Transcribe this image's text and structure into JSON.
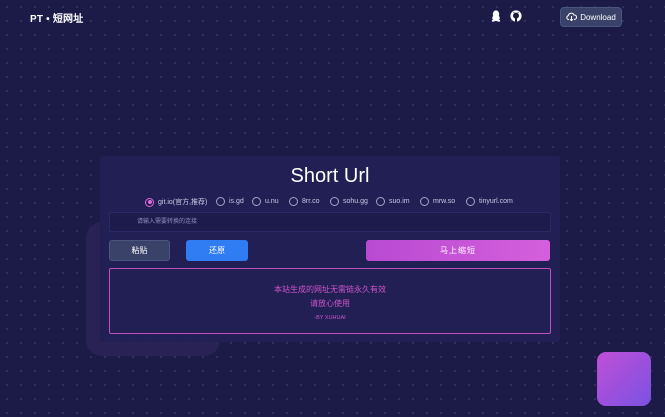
{
  "header": {
    "brand": "PT • 短网址",
    "icons": [
      "qq-penguin-icon",
      "github-icon"
    ],
    "download_label": "Download"
  },
  "main": {
    "title": "Short Url",
    "services": [
      {
        "label": "git.io(官方,推荐)",
        "selected": true
      },
      {
        "label": "is.gd",
        "selected": false
      },
      {
        "label": "u.nu",
        "selected": false
      },
      {
        "label": "8rr.co",
        "selected": false
      },
      {
        "label": "sohu.gg",
        "selected": false
      },
      {
        "label": "suo.im",
        "selected": false
      },
      {
        "label": "mrw.so",
        "selected": false
      },
      {
        "label": "tinyurl.com",
        "selected": false
      }
    ],
    "url_input": {
      "value": "",
      "placeholder": "请输入需要转换的连接"
    },
    "paste_label": "粘贴",
    "restore_label": "还原",
    "shorten_label": "马上缩短",
    "result": {
      "line1": "本站生成的网址无需链永久有效",
      "line2": "请放心使用",
      "line3": "-BY XUHUAI"
    }
  },
  "colors": {
    "background": "#1c1b48",
    "card": "#221f55",
    "accent_pink": "#cf55c8",
    "accent_blue": "#2f7cf3",
    "gradient_start": "#b84ad2",
    "gradient_end": "#d55fdc"
  }
}
